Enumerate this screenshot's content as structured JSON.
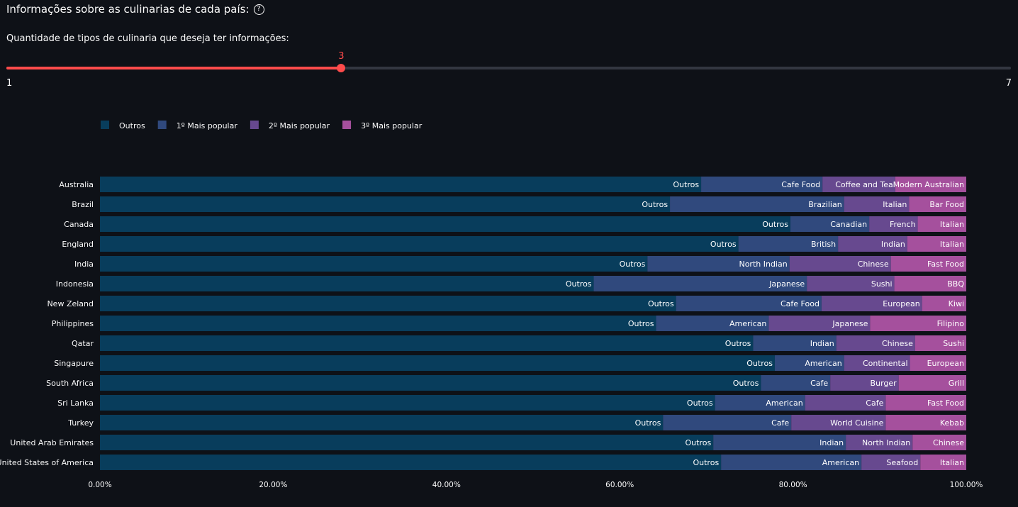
{
  "header": {
    "title": "Informações sobre as culinarias de cada país:",
    "help_icon": "question-circle-icon"
  },
  "slider": {
    "label": "Quantidade de tipos de culinaria que deseja ter informações:",
    "value": 3,
    "min": 1,
    "max": 7,
    "value_label": "3",
    "min_label": "1",
    "max_label": "7",
    "accent_color": "#ff4b4b"
  },
  "chart_data": {
    "type": "bar",
    "orientation": "horizontal",
    "stacked": true,
    "normalized": true,
    "xlim": [
      0,
      1
    ],
    "x_ticks": [
      "0.00%",
      "20.00%",
      "40.00%",
      "60.00%",
      "80.00%",
      "100.00%"
    ],
    "legend_position": "top-left",
    "grid": false,
    "categories": [
      "Australia",
      "Brazil",
      "Canada",
      "England",
      "India",
      "Indonesia",
      "New Zeland",
      "Philippines",
      "Qatar",
      "Singapure",
      "South Africa",
      "Sri Lanka",
      "Turkey",
      "United Arab Emirates",
      "United States of America"
    ],
    "series": [
      {
        "name": "Outros",
        "color": "#083d5c",
        "values": [
          0.694,
          0.658,
          0.797,
          0.737,
          0.632,
          0.57,
          0.665,
          0.642,
          0.754,
          0.779,
          0.763,
          0.71,
          0.65,
          0.708,
          0.717
        ],
        "labels": [
          "Outros",
          "Outros",
          "Outros",
          "Outros",
          "Outros",
          "Outros",
          "Outros",
          "Outros",
          "Outros",
          "Outros",
          "Outros",
          "Outros",
          "Outros",
          "Outros",
          "Outros"
        ]
      },
      {
        "name": "1º Mais popular",
        "color": "#30497d",
        "values": [
          0.14,
          0.201,
          0.091,
          0.115,
          0.164,
          0.246,
          0.168,
          0.13,
          0.096,
          0.08,
          0.08,
          0.104,
          0.148,
          0.153,
          0.162
        ],
        "labels": [
          "Cafe Food",
          "Brazilian",
          "Canadian",
          "British",
          "North Indian",
          "Japanese",
          "Cafe Food",
          "American",
          "Indian",
          "American",
          "Cafe",
          "American",
          "Cafe",
          "Indian",
          "American"
        ]
      },
      {
        "name": "2º Mais popular",
        "color": "#67498f",
        "values": [
          0.084,
          0.075,
          0.056,
          0.08,
          0.117,
          0.101,
          0.116,
          0.117,
          0.091,
          0.076,
          0.079,
          0.093,
          0.109,
          0.077,
          0.068
        ],
        "labels": [
          "Coffee and Tea",
          "Italian",
          "French",
          "Indian",
          "Chinese",
          "Sushi",
          "European",
          "Japanese",
          "Chinese",
          "Continental",
          "Burger",
          "Cafe",
          "World Cuisine",
          "North Indian",
          "Seafood"
        ]
      },
      {
        "name": "3º Mais popular",
        "color": "#a5509d",
        "values": [
          0.082,
          0.066,
          0.056,
          0.068,
          0.087,
          0.083,
          0.051,
          0.111,
          0.059,
          0.065,
          0.078,
          0.093,
          0.093,
          0.062,
          0.053
        ],
        "labels": [
          "Modern Australian",
          "Bar Food",
          "Italian",
          "Italian",
          "Fast Food",
          "BBQ",
          "Kiwi",
          "Filipino",
          "Sushi",
          "European",
          "Grill",
          "Fast Food",
          "Kebab",
          "Chinese",
          "Italian"
        ]
      }
    ]
  }
}
